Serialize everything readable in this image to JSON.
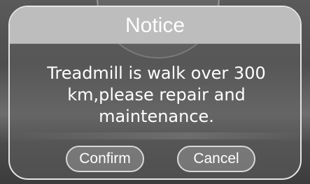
{
  "dialog": {
    "title": "Notice",
    "message_line1": "Treadmill is walk over 300",
    "message_line2": "km,please repair and",
    "message_line3": "maintenance.",
    "buttons": {
      "confirm": "Confirm",
      "cancel": "Cancel"
    }
  },
  "colors": {
    "header": "#bdbdbd",
    "dialog_border": "#e6e6e6",
    "text": "#ffffff"
  }
}
